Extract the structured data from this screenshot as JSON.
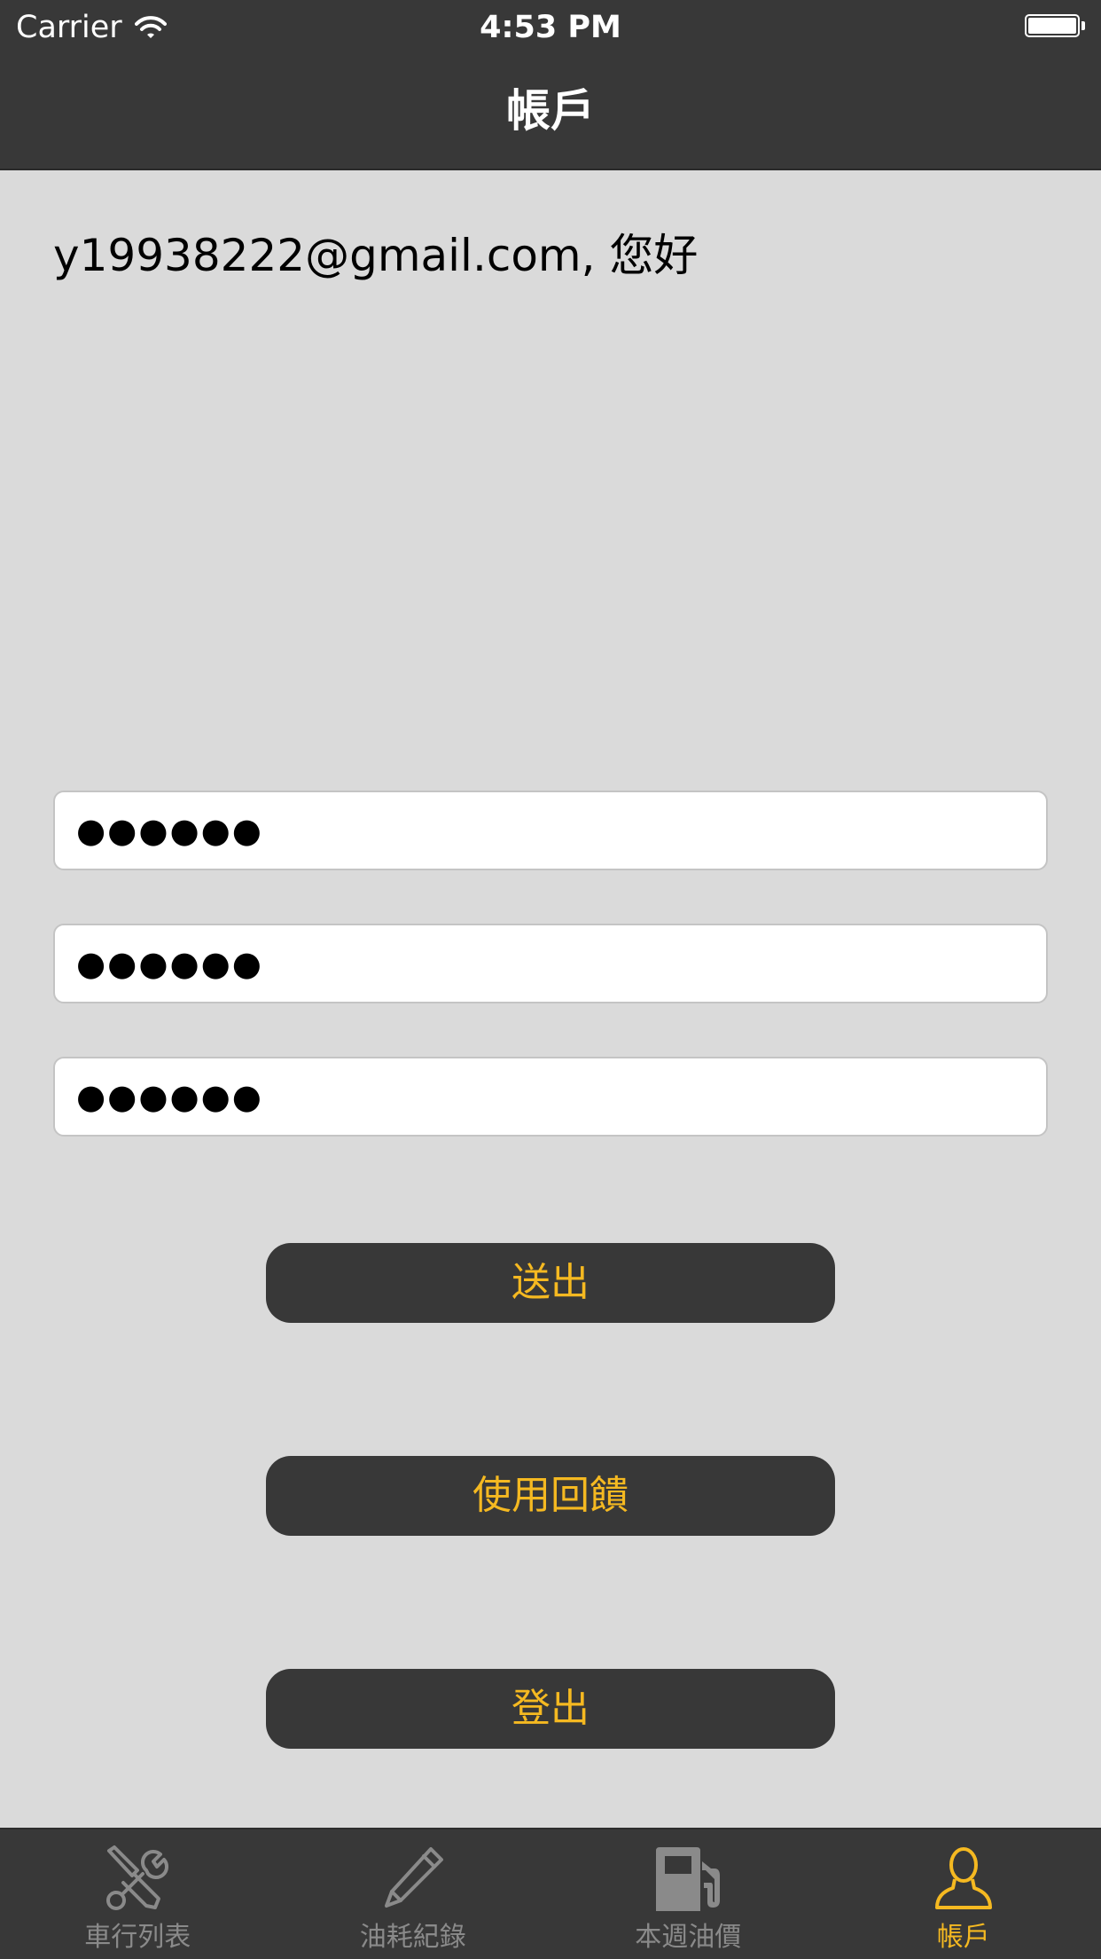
{
  "status_bar": {
    "carrier": "Carrier",
    "time": "4:53 PM",
    "wifi_icon": "wifi-icon",
    "battery_icon": "battery-icon",
    "battery_level": 1.0
  },
  "nav_bar": {
    "title": "帳戶"
  },
  "account": {
    "greeting": "y19938222@gmail.com, 您好"
  },
  "form": {
    "password_fields": [
      {
        "value": "●●●●●●"
      },
      {
        "value": "●●●●●●"
      },
      {
        "value": "●●●●●●"
      }
    ],
    "submit_label": "送出"
  },
  "buttons": {
    "feedback_label": "使用回饋",
    "logout_label": "登出"
  },
  "tab_bar": {
    "items": [
      {
        "label": "車行列表",
        "icon": "tools-icon",
        "active": false
      },
      {
        "label": "油耗紀錄",
        "icon": "pencil-icon",
        "active": false
      },
      {
        "label": "本週油價",
        "icon": "fuel-pump-icon",
        "active": false
      },
      {
        "label": "帳戶",
        "icon": "person-icon",
        "active": true
      }
    ]
  },
  "colors": {
    "bar_background": "#383838",
    "page_background": "#dadada",
    "accent": "#f5b921",
    "tab_inactive": "#8a8a8a"
  }
}
